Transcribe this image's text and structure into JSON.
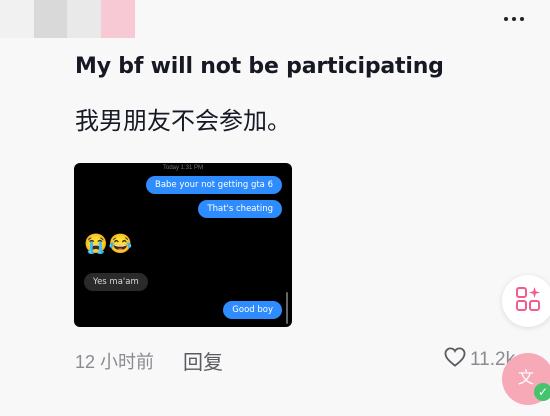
{
  "post": {
    "title": "My bf will not be participating",
    "translation": "我男朋友不会参加。"
  },
  "chat": {
    "timestamp": "Today 1:31 PM",
    "messages": [
      {
        "text": "Babe your not getting gta 6",
        "side": "out"
      },
      {
        "text": "That's cheating",
        "side": "out"
      },
      {
        "text": "😭😂",
        "side": "in-emoji"
      },
      {
        "text": "Yes ma'am",
        "side": "in"
      },
      {
        "text": "Good boy",
        "side": "out"
      }
    ]
  },
  "meta": {
    "time": "12 小时前",
    "reply_label": "回复",
    "like_count": "11.2k"
  },
  "icons": {
    "more": "more-horizontal-icon",
    "like": "heart-outline-icon",
    "fab1": "grid-sparkle-icon",
    "fab2": "translate-check-icon"
  },
  "colors": {
    "title_text": "#161823",
    "meta_text": "#8a8b91",
    "bubble_out": "#2f8cff",
    "bubble_in": "#2a2a2a",
    "accent_pink": "#f35b8c"
  }
}
